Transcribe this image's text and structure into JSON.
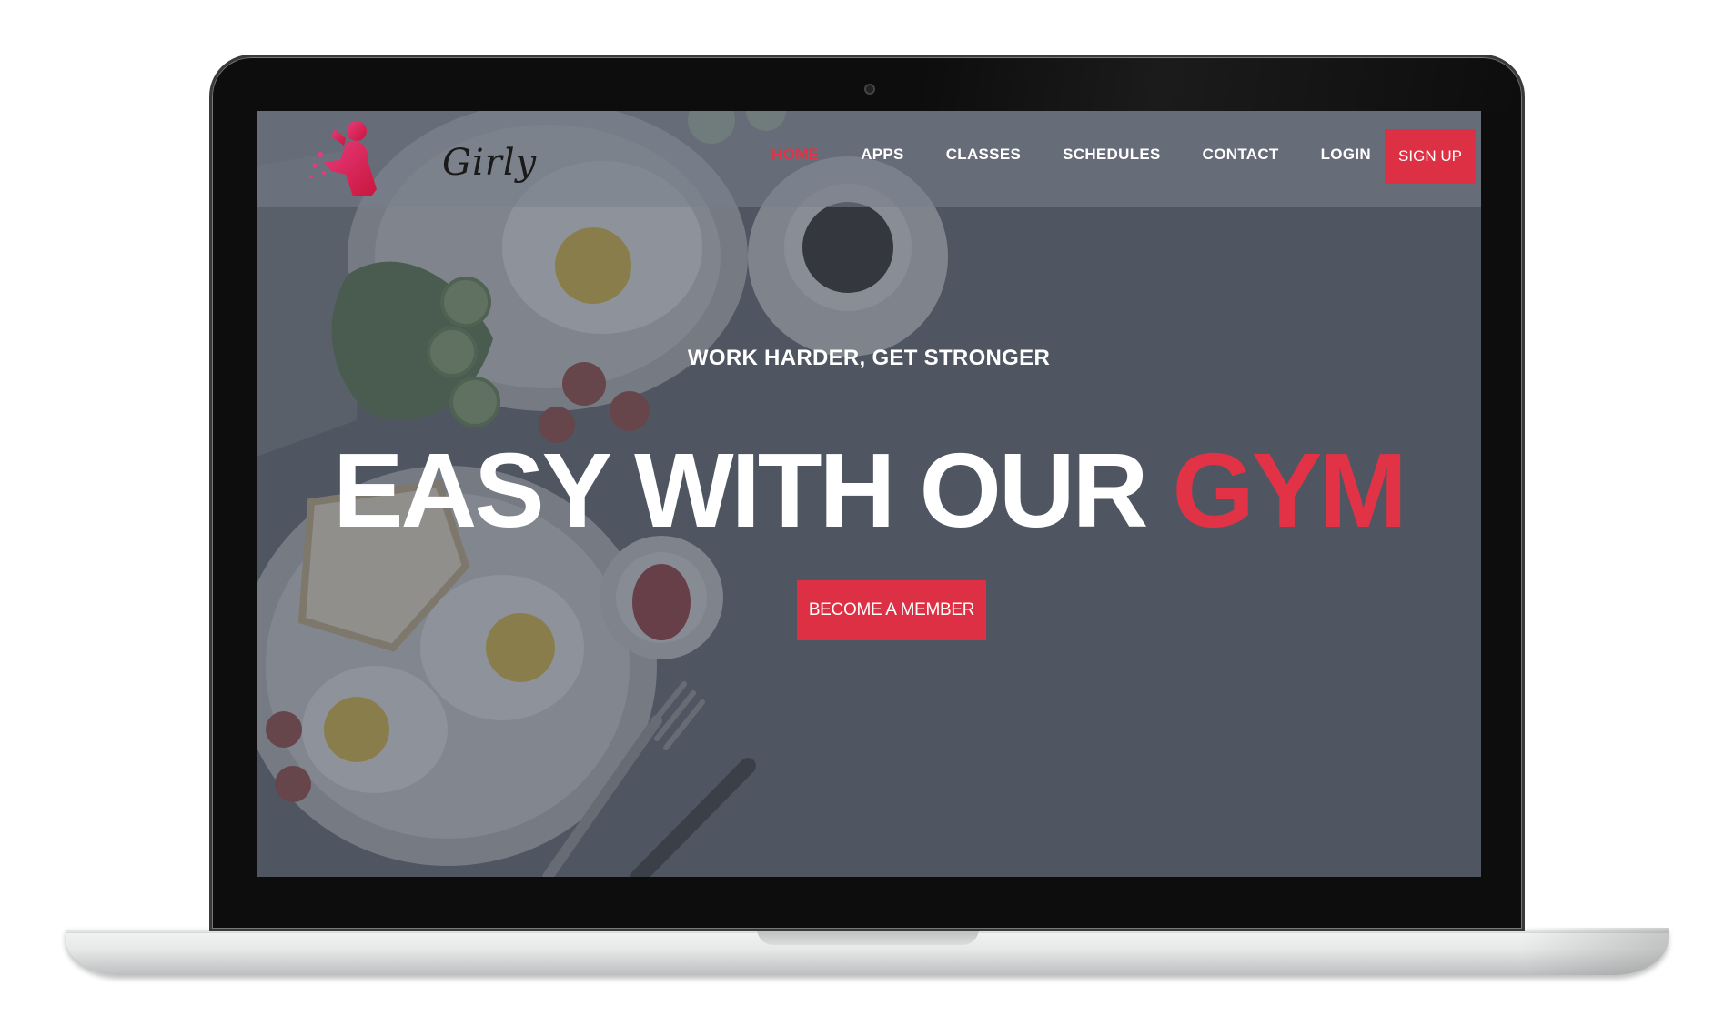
{
  "brand": {
    "name": "Girly",
    "logo_icon": "woman-figure-icon",
    "accent_color": "#de3044"
  },
  "nav": {
    "items": [
      {
        "label": "HOME",
        "active": true
      },
      {
        "label": "APPS",
        "active": false
      },
      {
        "label": "CLASSES",
        "active": false
      },
      {
        "label": "SCHEDULES",
        "active": false
      },
      {
        "label": "CONTACT",
        "active": false
      },
      {
        "label": "LOGIN",
        "active": false
      }
    ],
    "signup_label": "SIGN UP"
  },
  "hero": {
    "tagline": "WORK HARDER, GET STRONGER",
    "headline_main": "EASY WITH OUR ",
    "headline_accent": "GYM",
    "cta_label": "BECOME A MEMBER",
    "background": "breakfast-table-photo"
  }
}
